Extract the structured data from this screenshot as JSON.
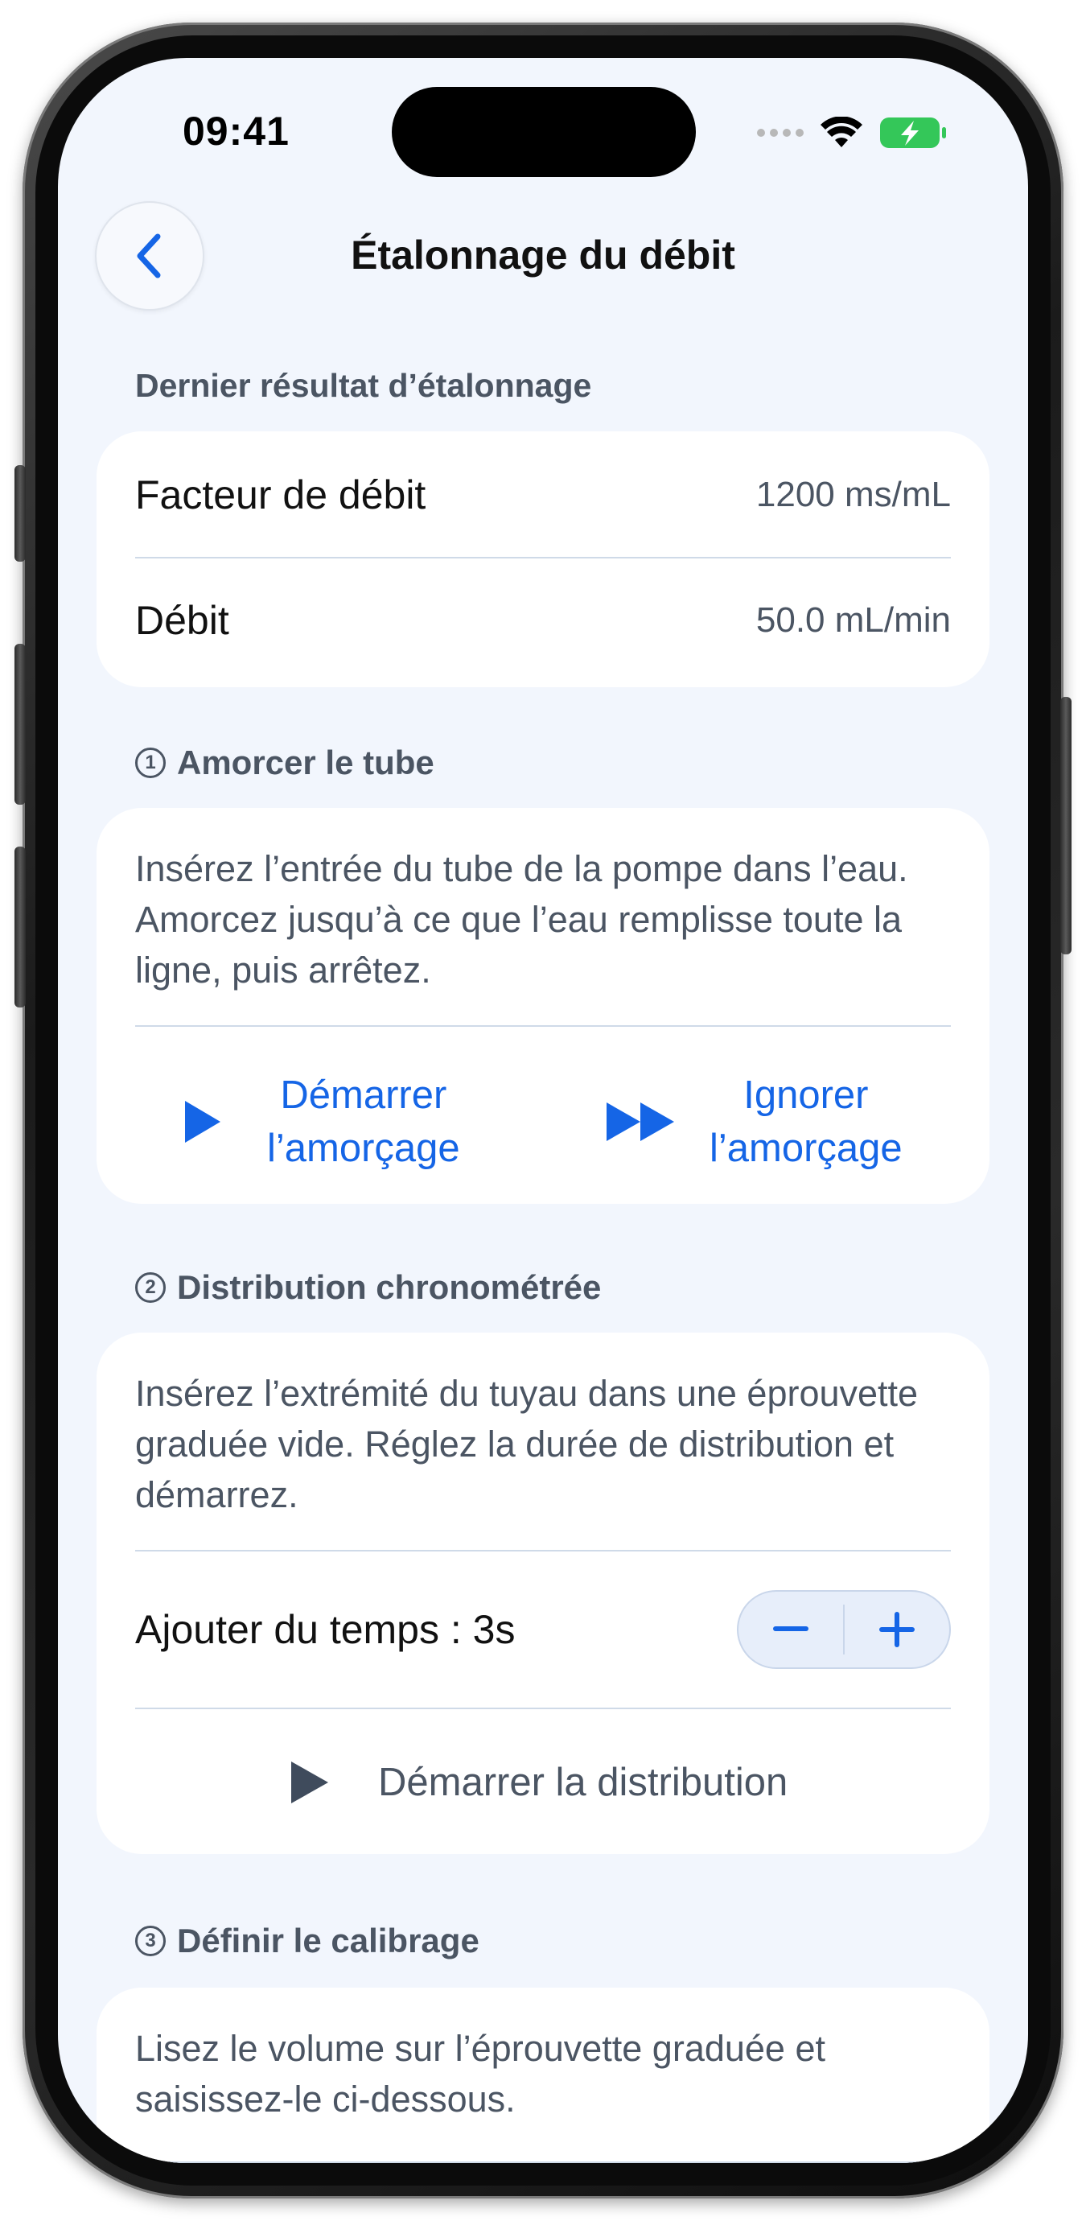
{
  "status_bar": {
    "time": "09:41"
  },
  "nav": {
    "title": "Étalonnage du débit",
    "back_icon": "chevron-left-icon"
  },
  "last_result": {
    "header": "Dernier résultat d’étalonnage",
    "rows": [
      {
        "label": "Facteur de débit",
        "value": "1200 ms/mL"
      },
      {
        "label": "Débit",
        "value": "50.0 mL/min"
      }
    ]
  },
  "step1": {
    "number": "1",
    "header": "Amorcer le tube",
    "description": "Insérez l’entrée du tube de la pompe dans l’eau. Amorcez jusqu’à ce que l’eau remplisse toute la ligne, puis arrêtez.",
    "start_label_line1": "Démarrer",
    "start_label_line2": "l’amorçage",
    "skip_label_line1": "Ignorer",
    "skip_label_line2": "l’amorçage"
  },
  "step2": {
    "number": "2",
    "header": "Distribution chronométrée",
    "description": "Insérez l’extrémité du tuyau dans une éprouvette graduée vide. Réglez la durée de distribution et démarrez.",
    "add_time_label": "Ajouter du temps : 3s",
    "start_label": "Démarrer la distribution"
  },
  "step3": {
    "number": "3",
    "header": "Définir le calibrage",
    "description": "Lisez le volume sur l’éprouvette graduée et saisissez-le ci-dessous."
  },
  "colors": {
    "accent": "#1565e6",
    "background": "#f2f6fd",
    "card": "#ffffff",
    "secondary_text": "#4b5563",
    "battery": "#34c759"
  }
}
